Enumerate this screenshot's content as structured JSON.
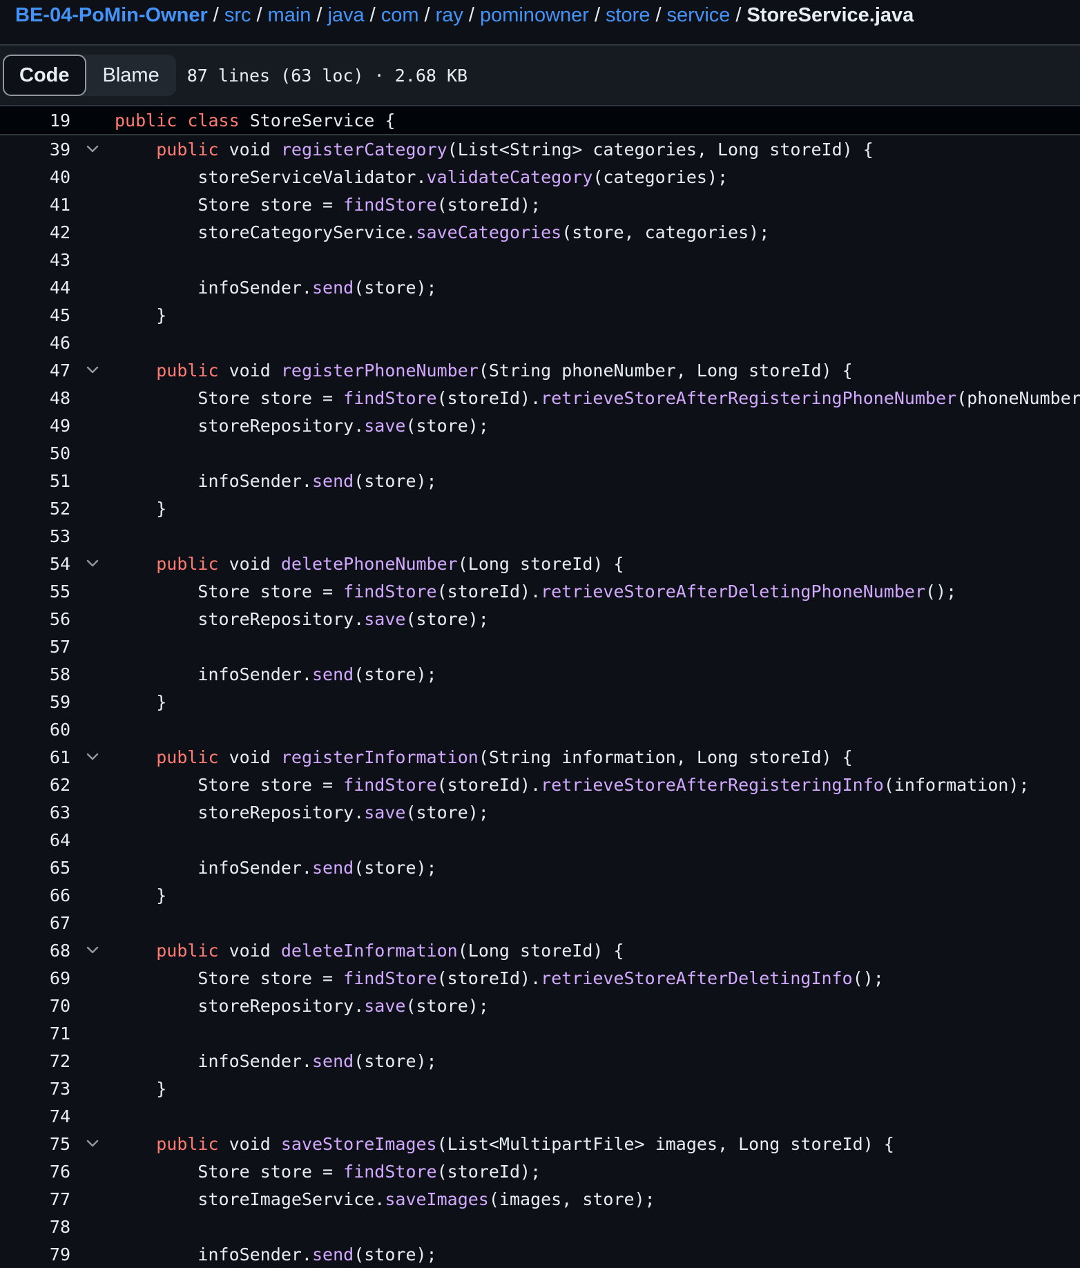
{
  "breadcrumb": {
    "repo": "BE-04-PoMin-Owner",
    "segments": [
      "src",
      "main",
      "java",
      "com",
      "ray",
      "pominowner",
      "store",
      "service"
    ],
    "separator": "/",
    "current": "StoreService.java"
  },
  "toolbar": {
    "code_label": "Code",
    "blame_label": "Blame",
    "file_info": "87 lines (63 loc) · 2.68 KB"
  },
  "sticky": {
    "number": "19",
    "tokens": [
      {
        "t": "public",
        "c": "kw"
      },
      {
        "t": " ",
        "c": "pl"
      },
      {
        "t": "class",
        "c": "kw"
      },
      {
        "t": " StoreService {",
        "c": "pl"
      }
    ]
  },
  "lines": [
    {
      "n": "39",
      "fold": true,
      "tokens": [
        {
          "t": "    ",
          "c": "pl"
        },
        {
          "t": "public",
          "c": "kw"
        },
        {
          "t": " void ",
          "c": "pl"
        },
        {
          "t": "registerCategory",
          "c": "fn"
        },
        {
          "t": "(List<String> categories, Long storeId) {",
          "c": "pl"
        }
      ]
    },
    {
      "n": "40",
      "fold": false,
      "tokens": [
        {
          "t": "        storeServiceValidator.",
          "c": "pl"
        },
        {
          "t": "validateCategory",
          "c": "fn"
        },
        {
          "t": "(categories);",
          "c": "pl"
        }
      ]
    },
    {
      "n": "41",
      "fold": false,
      "tokens": [
        {
          "t": "        Store store = ",
          "c": "pl"
        },
        {
          "t": "findStore",
          "c": "fn"
        },
        {
          "t": "(storeId);",
          "c": "pl"
        }
      ]
    },
    {
      "n": "42",
      "fold": false,
      "tokens": [
        {
          "t": "        storeCategoryService.",
          "c": "pl"
        },
        {
          "t": "saveCategories",
          "c": "fn"
        },
        {
          "t": "(store, categories);",
          "c": "pl"
        }
      ]
    },
    {
      "n": "43",
      "fold": false,
      "tokens": []
    },
    {
      "n": "44",
      "fold": false,
      "tokens": [
        {
          "t": "        infoSender.",
          "c": "pl"
        },
        {
          "t": "send",
          "c": "fn"
        },
        {
          "t": "(store);",
          "c": "pl"
        }
      ]
    },
    {
      "n": "45",
      "fold": false,
      "tokens": [
        {
          "t": "    }",
          "c": "pl"
        }
      ]
    },
    {
      "n": "46",
      "fold": false,
      "tokens": []
    },
    {
      "n": "47",
      "fold": true,
      "tokens": [
        {
          "t": "    ",
          "c": "pl"
        },
        {
          "t": "public",
          "c": "kw"
        },
        {
          "t": " void ",
          "c": "pl"
        },
        {
          "t": "registerPhoneNumber",
          "c": "fn"
        },
        {
          "t": "(String phoneNumber, Long storeId) {",
          "c": "pl"
        }
      ]
    },
    {
      "n": "48",
      "fold": false,
      "tokens": [
        {
          "t": "        Store store = ",
          "c": "pl"
        },
        {
          "t": "findStore",
          "c": "fn"
        },
        {
          "t": "(storeId).",
          "c": "pl"
        },
        {
          "t": "retrieveStoreAfterRegisteringPhoneNumber",
          "c": "fn"
        },
        {
          "t": "(phoneNumber);",
          "c": "pl"
        }
      ]
    },
    {
      "n": "49",
      "fold": false,
      "tokens": [
        {
          "t": "        storeRepository.",
          "c": "pl"
        },
        {
          "t": "save",
          "c": "fn"
        },
        {
          "t": "(store);",
          "c": "pl"
        }
      ]
    },
    {
      "n": "50",
      "fold": false,
      "tokens": []
    },
    {
      "n": "51",
      "fold": false,
      "tokens": [
        {
          "t": "        infoSender.",
          "c": "pl"
        },
        {
          "t": "send",
          "c": "fn"
        },
        {
          "t": "(store);",
          "c": "pl"
        }
      ]
    },
    {
      "n": "52",
      "fold": false,
      "tokens": [
        {
          "t": "    }",
          "c": "pl"
        }
      ]
    },
    {
      "n": "53",
      "fold": false,
      "tokens": []
    },
    {
      "n": "54",
      "fold": true,
      "tokens": [
        {
          "t": "    ",
          "c": "pl"
        },
        {
          "t": "public",
          "c": "kw"
        },
        {
          "t": " void ",
          "c": "pl"
        },
        {
          "t": "deletePhoneNumber",
          "c": "fn"
        },
        {
          "t": "(Long storeId) {",
          "c": "pl"
        }
      ]
    },
    {
      "n": "55",
      "fold": false,
      "tokens": [
        {
          "t": "        Store store = ",
          "c": "pl"
        },
        {
          "t": "findStore",
          "c": "fn"
        },
        {
          "t": "(storeId).",
          "c": "pl"
        },
        {
          "t": "retrieveStoreAfterDeletingPhoneNumber",
          "c": "fn"
        },
        {
          "t": "();",
          "c": "pl"
        }
      ]
    },
    {
      "n": "56",
      "fold": false,
      "tokens": [
        {
          "t": "        storeRepository.",
          "c": "pl"
        },
        {
          "t": "save",
          "c": "fn"
        },
        {
          "t": "(store);",
          "c": "pl"
        }
      ]
    },
    {
      "n": "57",
      "fold": false,
      "tokens": []
    },
    {
      "n": "58",
      "fold": false,
      "tokens": [
        {
          "t": "        infoSender.",
          "c": "pl"
        },
        {
          "t": "send",
          "c": "fn"
        },
        {
          "t": "(store);",
          "c": "pl"
        }
      ]
    },
    {
      "n": "59",
      "fold": false,
      "tokens": [
        {
          "t": "    }",
          "c": "pl"
        }
      ]
    },
    {
      "n": "60",
      "fold": false,
      "tokens": []
    },
    {
      "n": "61",
      "fold": true,
      "tokens": [
        {
          "t": "    ",
          "c": "pl"
        },
        {
          "t": "public",
          "c": "kw"
        },
        {
          "t": " void ",
          "c": "pl"
        },
        {
          "t": "registerInformation",
          "c": "fn"
        },
        {
          "t": "(String information, Long storeId) {",
          "c": "pl"
        }
      ]
    },
    {
      "n": "62",
      "fold": false,
      "tokens": [
        {
          "t": "        Store store = ",
          "c": "pl"
        },
        {
          "t": "findStore",
          "c": "fn"
        },
        {
          "t": "(storeId).",
          "c": "pl"
        },
        {
          "t": "retrieveStoreAfterRegisteringInfo",
          "c": "fn"
        },
        {
          "t": "(information);",
          "c": "pl"
        }
      ]
    },
    {
      "n": "63",
      "fold": false,
      "tokens": [
        {
          "t": "        storeRepository.",
          "c": "pl"
        },
        {
          "t": "save",
          "c": "fn"
        },
        {
          "t": "(store);",
          "c": "pl"
        }
      ]
    },
    {
      "n": "64",
      "fold": false,
      "tokens": []
    },
    {
      "n": "65",
      "fold": false,
      "tokens": [
        {
          "t": "        infoSender.",
          "c": "pl"
        },
        {
          "t": "send",
          "c": "fn"
        },
        {
          "t": "(store);",
          "c": "pl"
        }
      ]
    },
    {
      "n": "66",
      "fold": false,
      "tokens": [
        {
          "t": "    }",
          "c": "pl"
        }
      ]
    },
    {
      "n": "67",
      "fold": false,
      "tokens": []
    },
    {
      "n": "68",
      "fold": true,
      "tokens": [
        {
          "t": "    ",
          "c": "pl"
        },
        {
          "t": "public",
          "c": "kw"
        },
        {
          "t": " void ",
          "c": "pl"
        },
        {
          "t": "deleteInformation",
          "c": "fn"
        },
        {
          "t": "(Long storeId) {",
          "c": "pl"
        }
      ]
    },
    {
      "n": "69",
      "fold": false,
      "tokens": [
        {
          "t": "        Store store = ",
          "c": "pl"
        },
        {
          "t": "findStore",
          "c": "fn"
        },
        {
          "t": "(storeId).",
          "c": "pl"
        },
        {
          "t": "retrieveStoreAfterDeletingInfo",
          "c": "fn"
        },
        {
          "t": "();",
          "c": "pl"
        }
      ]
    },
    {
      "n": "70",
      "fold": false,
      "tokens": [
        {
          "t": "        storeRepository.",
          "c": "pl"
        },
        {
          "t": "save",
          "c": "fn"
        },
        {
          "t": "(store);",
          "c": "pl"
        }
      ]
    },
    {
      "n": "71",
      "fold": false,
      "tokens": []
    },
    {
      "n": "72",
      "fold": false,
      "tokens": [
        {
          "t": "        infoSender.",
          "c": "pl"
        },
        {
          "t": "send",
          "c": "fn"
        },
        {
          "t": "(store);",
          "c": "pl"
        }
      ]
    },
    {
      "n": "73",
      "fold": false,
      "tokens": [
        {
          "t": "    }",
          "c": "pl"
        }
      ]
    },
    {
      "n": "74",
      "fold": false,
      "tokens": []
    },
    {
      "n": "75",
      "fold": true,
      "tokens": [
        {
          "t": "    ",
          "c": "pl"
        },
        {
          "t": "public",
          "c": "kw"
        },
        {
          "t": " void ",
          "c": "pl"
        },
        {
          "t": "saveStoreImages",
          "c": "fn"
        },
        {
          "t": "(List<MultipartFile> images, Long storeId) {",
          "c": "pl"
        }
      ]
    },
    {
      "n": "76",
      "fold": false,
      "tokens": [
        {
          "t": "        Store store = ",
          "c": "pl"
        },
        {
          "t": "findStore",
          "c": "fn"
        },
        {
          "t": "(storeId);",
          "c": "pl"
        }
      ]
    },
    {
      "n": "77",
      "fold": false,
      "tokens": [
        {
          "t": "        storeImageService.",
          "c": "pl"
        },
        {
          "t": "saveImages",
          "c": "fn"
        },
        {
          "t": "(images, store);",
          "c": "pl"
        }
      ]
    },
    {
      "n": "78",
      "fold": false,
      "tokens": []
    },
    {
      "n": "79",
      "fold": false,
      "tokens": [
        {
          "t": "        infoSender.",
          "c": "pl"
        },
        {
          "t": "send",
          "c": "fn"
        },
        {
          "t": "(store);",
          "c": "pl"
        }
      ]
    }
  ],
  "colors": {
    "background": "#0d1117",
    "keyword": "#ff7b72",
    "function": "#d2a8ff",
    "link": "#4493f8",
    "text": "#e6edf3"
  },
  "icons": {
    "fold": "chevron-down-icon"
  }
}
